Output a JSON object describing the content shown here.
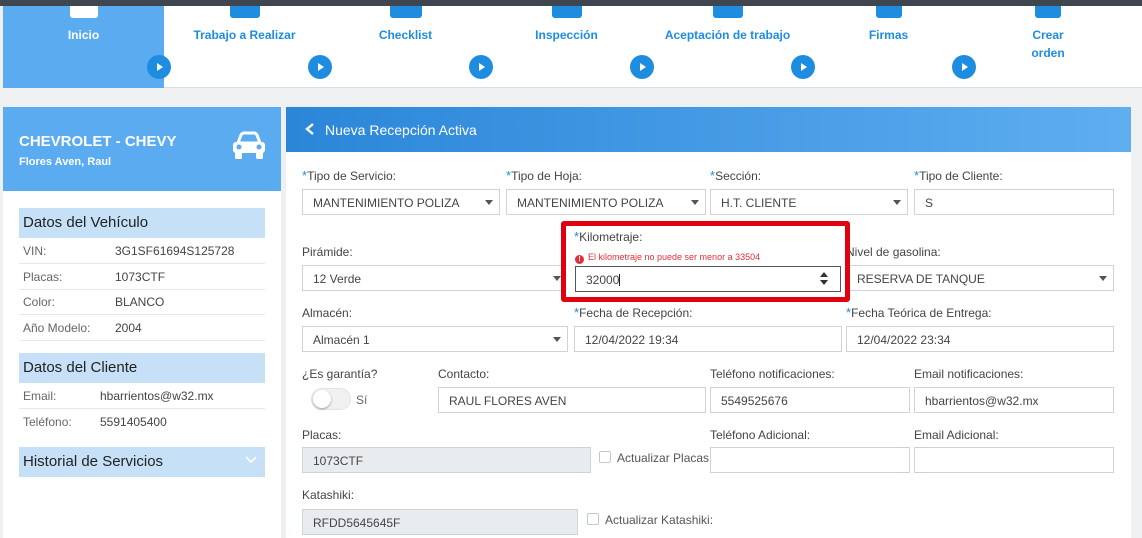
{
  "stepper": {
    "steps": [
      "Inicio",
      "Trabajo a Realizar",
      "Checklist",
      "Inspección",
      "Aceptación de trabajo",
      "Firmas",
      "Crear orden"
    ],
    "active_index": 0
  },
  "vehicle": {
    "title": "CHEVROLET - CHEVY",
    "owner": "Flores Aven, Raul"
  },
  "vehicle_data": {
    "heading": "Datos del Vehículo",
    "rows": [
      {
        "label": "VIN:",
        "value": "3G1SF61694S125728"
      },
      {
        "label": "Placas:",
        "value": "1073CTF"
      },
      {
        "label": "Color:",
        "value": "BLANCO"
      },
      {
        "label": "Año Modelo:",
        "value": "2004"
      }
    ]
  },
  "client_data": {
    "heading": "Datos del Cliente",
    "rows": [
      {
        "label": "Email:",
        "value": "hbarrientos@w32.mx"
      },
      {
        "label": "Teléfono:",
        "value": "5591405400"
      }
    ]
  },
  "history": {
    "heading": "Historial de Servicios"
  },
  "form": {
    "header_title": "Nueva Recepción Activa",
    "tipo_servicio": {
      "label": "Tipo de Servicio:",
      "value": "MANTENIMIENTO POLIZA"
    },
    "tipo_hoja": {
      "label": "Tipo de Hoja:",
      "value": "MANTENIMIENTO POLIZA"
    },
    "seccion": {
      "label": "Sección:",
      "value": "H.T. CLIENTE"
    },
    "tipo_cliente": {
      "label": "Tipo de Cliente:",
      "value": "S"
    },
    "piramide": {
      "label": "Pirámide:",
      "value": "12 Verde"
    },
    "kilometraje": {
      "label": "Kilometraje:",
      "value": "32000",
      "error": "El kilometraje no puede ser menor a 33504"
    },
    "nivel_gasolina": {
      "label": "Nivel de gasolina:",
      "value": "RESERVA DE TANQUE"
    },
    "almacen": {
      "label": "Almacén:",
      "value": "Almacén 1"
    },
    "fecha_recepcion": {
      "label": "Fecha de Recepción:",
      "value": "12/04/2022 19:34"
    },
    "fecha_entrega": {
      "label": "Fecha Teórica de Entrega:",
      "value": "12/04/2022 23:34"
    },
    "garantia": {
      "label": "¿Es garantía?",
      "toggle_text": "Sí"
    },
    "contacto": {
      "label": "Contacto:",
      "value": "RAUL FLORES AVEN"
    },
    "telefono_notif": {
      "label": "Teléfono notificaciones:",
      "value": "5549525676"
    },
    "email_notif": {
      "label": "Email notificaciones:",
      "value": "hbarrientos@w32.mx"
    },
    "placas": {
      "label": "Placas:",
      "value": "1073CTF",
      "check_label": "Actualizar Placas:"
    },
    "telefono_adicional": {
      "label": "Teléfono Adicional:",
      "value": ""
    },
    "email_adicional": {
      "label": "Email Adicional:",
      "value": ""
    },
    "katashiki": {
      "label": "Katashiki:",
      "value": "RFDD5645645F",
      "check_label": "Actualizar Katashiki:"
    },
    "required_mark": "*"
  },
  "colors": {
    "accent": "#1e8de0",
    "active_step": "#5aabf0",
    "section_head": "#c6e1f7",
    "error": "#e0000e"
  },
  "icons": [
    "home-icon",
    "wrench-icon",
    "clipboard-icon",
    "car-inspection-icon",
    "handshake-icon",
    "signature-icon",
    "new-order-icon",
    "car-icon",
    "chevron-down-icon",
    "back-arrow-icon",
    "error-icon"
  ]
}
